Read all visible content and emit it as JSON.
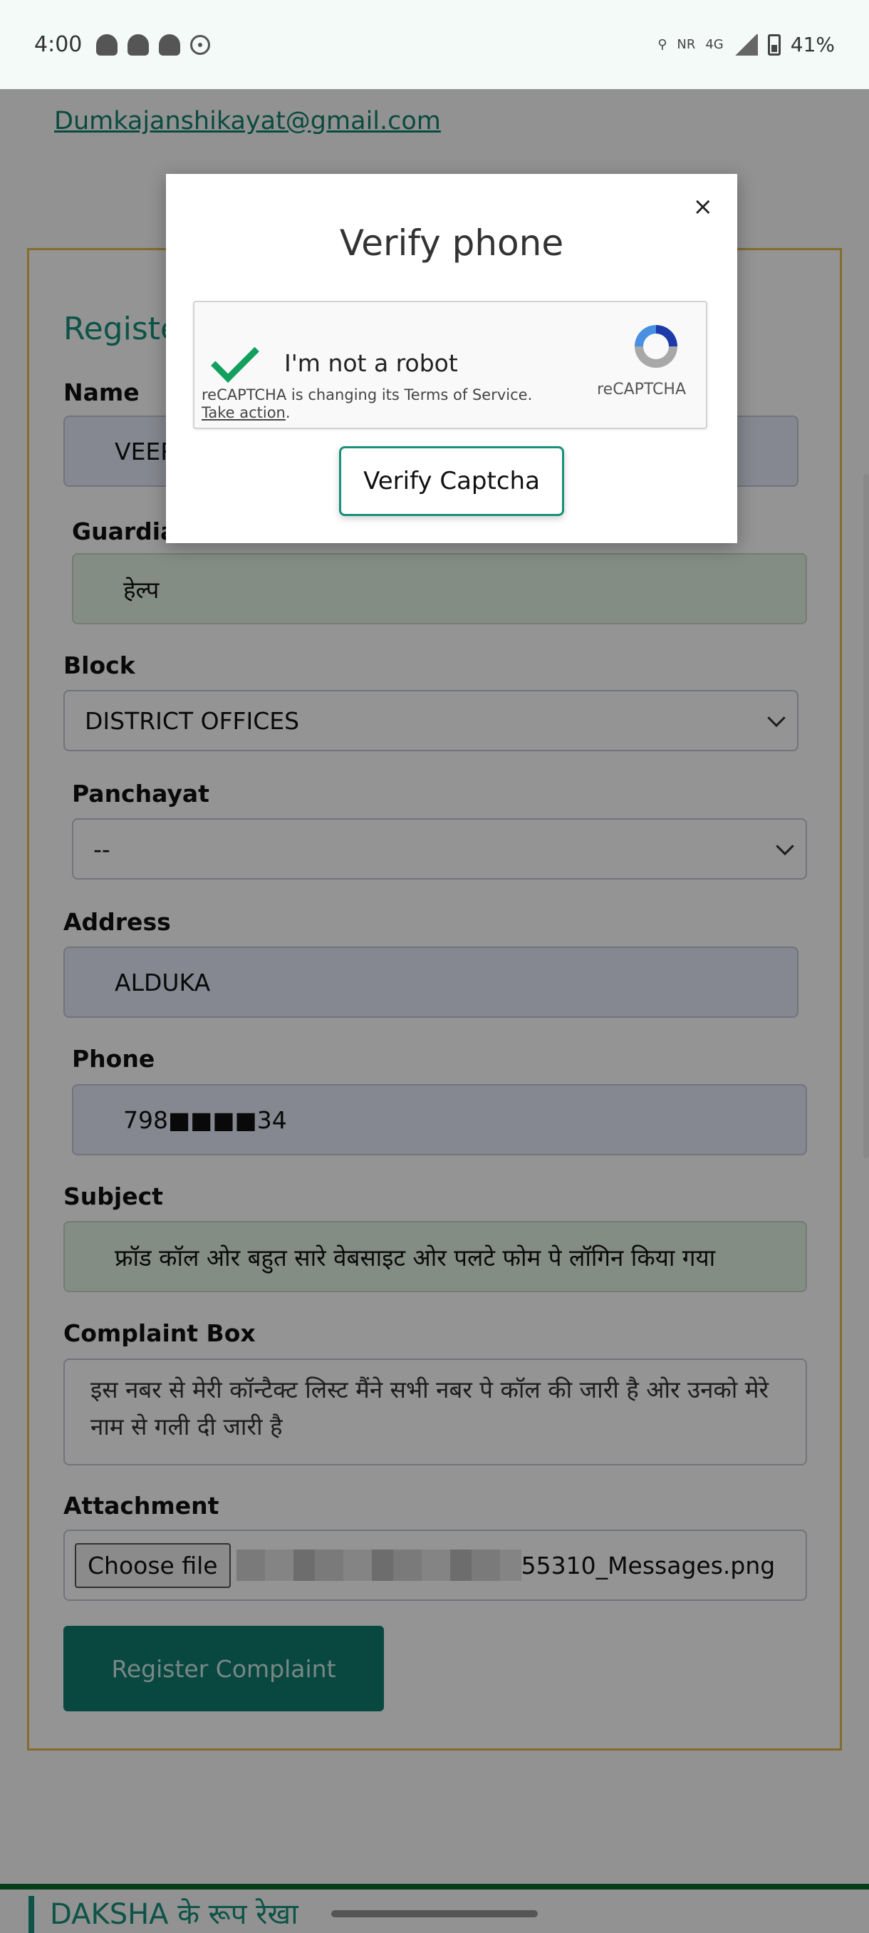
{
  "status_bar": {
    "time": "4:00",
    "network_nr": "NR",
    "network_4g": "4G",
    "battery": "41%",
    "icons": [
      "snapchat-icon",
      "snapchat-icon",
      "snapchat-icon",
      "location-pin-icon",
      "wifi-calling-icon",
      "signal-icon",
      "battery-icon"
    ]
  },
  "page": {
    "email": "Dumkajanshikayat@gmail.com",
    "form_title": "Register Complaint",
    "fields": {
      "name": {
        "label": "Name",
        "value": "VEER"
      },
      "guardian": {
        "label": "Guardian Name",
        "value": "हेल्प"
      },
      "block": {
        "label": "Block",
        "value": "DISTRICT OFFICES"
      },
      "panchayat": {
        "label": "Panchayat",
        "value": "--"
      },
      "address": {
        "label": "Address",
        "value": "ALDUKA"
      },
      "phone": {
        "label": "Phone",
        "value": "798■■■■34"
      },
      "subject": {
        "label": "Subject",
        "value": "फ्रॉड कॉल ओर बहुत सारे वेबसाइट ओर पलटे फोम पे लॉगिन किया गया"
      },
      "complaint": {
        "label": "Complaint Box",
        "value": "इस नबर से मेरी कॉन्टैक्ट लिस्ट मैंने सभी नबर पे कॉल की जारी है ओर उनको मेरे नाम से गली दी जारी है"
      },
      "attachment": {
        "label": "Attachment",
        "choose_label": "Choose file",
        "file_name": "55310_Messages.png"
      }
    },
    "submit_label": "Register Complaint",
    "footer_title": "DAKSHA के रूप रेखा"
  },
  "modal": {
    "title": "Verify phone",
    "close": "×",
    "recaptcha": {
      "label": "I'm not a robot",
      "notice": "reCAPTCHA is changing its Terms of Service.",
      "notice_link": "Take action",
      "brand": "reCAPTCHA"
    },
    "verify_label": "Verify Captcha"
  },
  "colors": {
    "accent": "#17907a",
    "button": "#0f7d70",
    "card_border": "#e6b94d",
    "check": "#139f5e"
  }
}
